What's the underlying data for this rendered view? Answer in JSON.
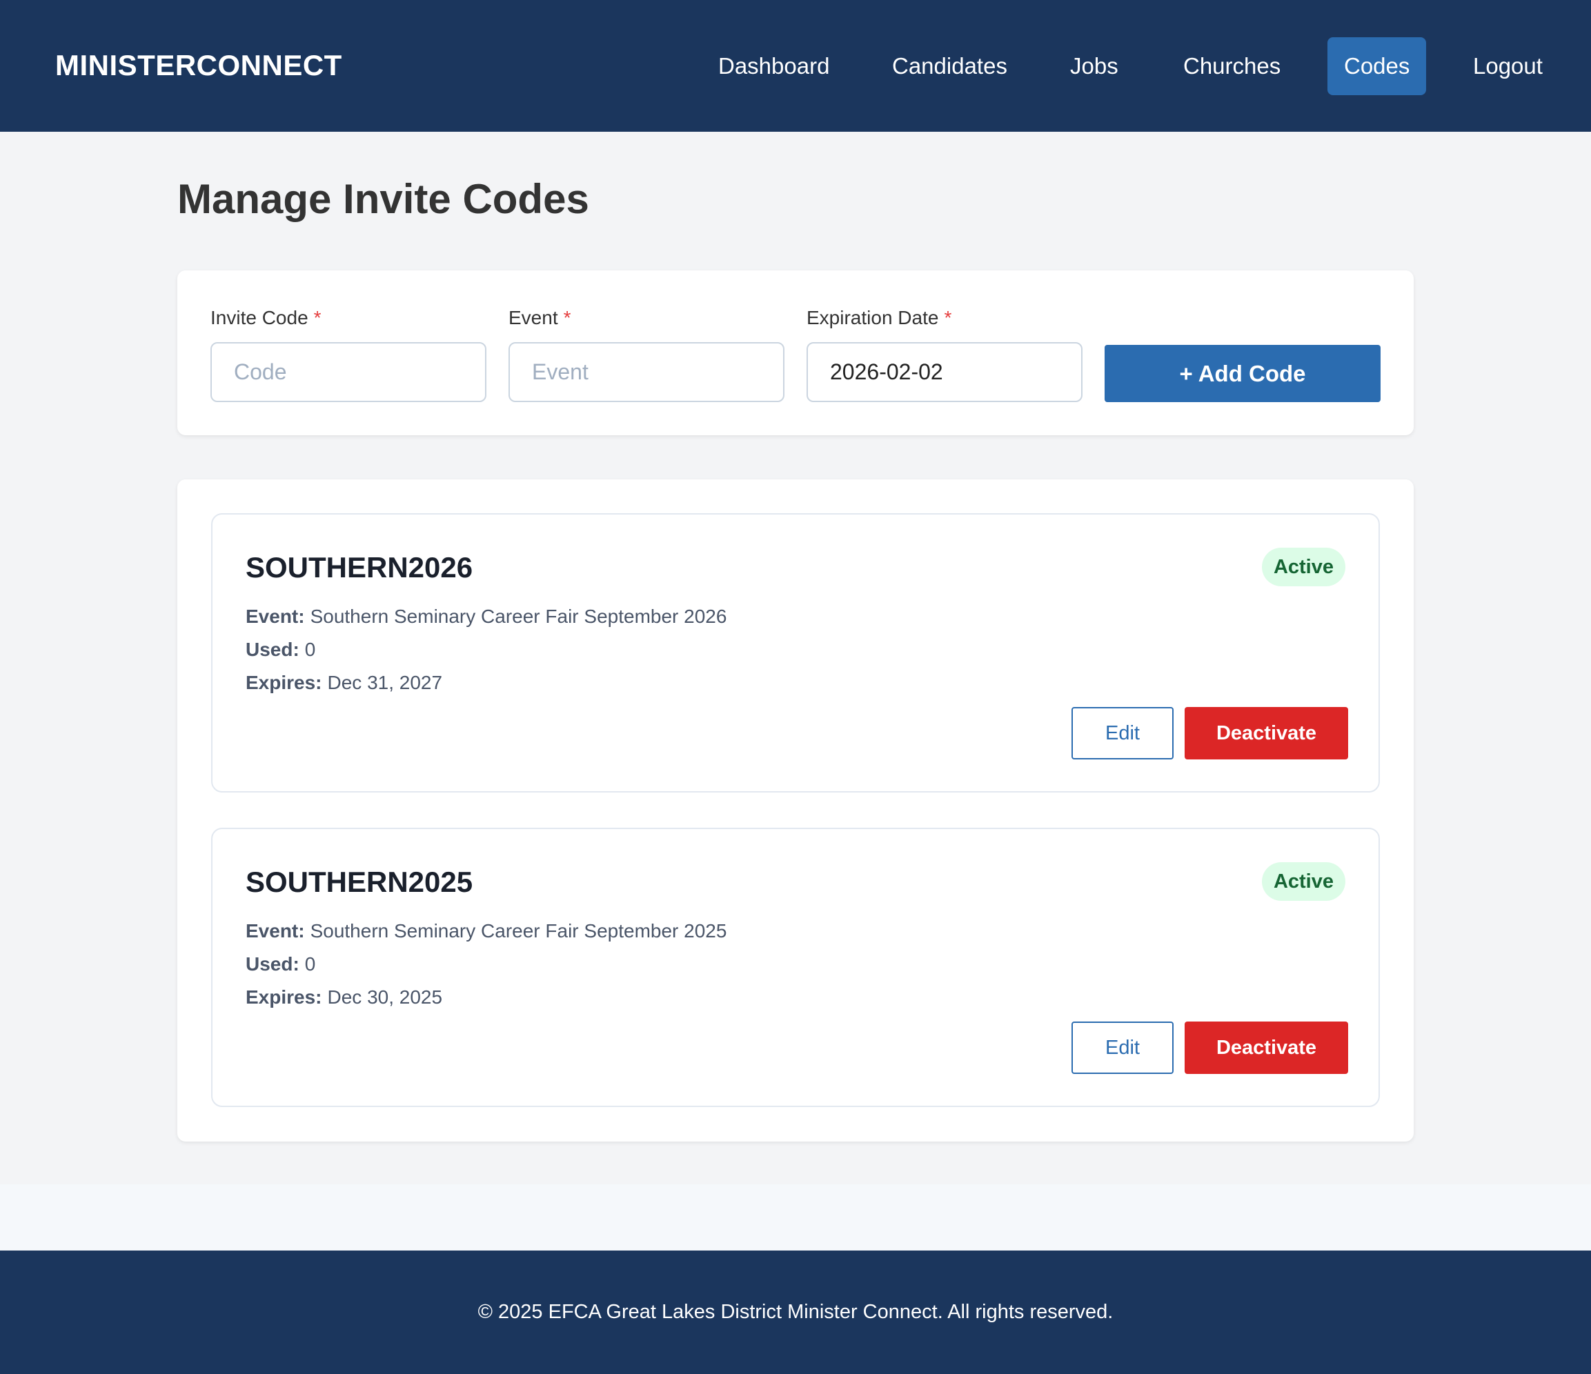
{
  "header": {
    "brand": "MINISTERCONNECT",
    "nav": {
      "dashboard": "Dashboard",
      "candidates": "Candidates",
      "jobs": "Jobs",
      "churches": "Churches",
      "codes": "Codes",
      "logout": "Logout"
    },
    "active_nav": "Codes"
  },
  "page": {
    "title": "Manage Invite Codes"
  },
  "form": {
    "invite_code": {
      "label": "Invite Code",
      "required_mark": "*",
      "placeholder": "Code",
      "value": ""
    },
    "event": {
      "label": "Event",
      "required_mark": "*",
      "placeholder": "Event",
      "value": ""
    },
    "expiration_date": {
      "label": "Expiration Date",
      "required_mark": "*",
      "value": "2026-02-02"
    },
    "add_button": "+ Add Code"
  },
  "codes": [
    {
      "code": "SOUTHERN2026",
      "status": "Active",
      "event_label": "Event:",
      "event": "Southern Seminary Career Fair September 2026",
      "used_label": "Used:",
      "used": "0",
      "expires_label": "Expires:",
      "expires": "Dec 31, 2027",
      "edit_label": "Edit",
      "deactivate_label": "Deactivate"
    },
    {
      "code": "SOUTHERN2025",
      "status": "Active",
      "event_label": "Event:",
      "event": "Southern Seminary Career Fair September 2025",
      "used_label": "Used:",
      "used": "0",
      "expires_label": "Expires:",
      "expires": "Dec 30, 2025",
      "edit_label": "Edit",
      "deactivate_label": "Deactivate"
    }
  ],
  "footer": {
    "text": "© 2025 EFCA Great Lakes District Minister Connect. All rights reserved."
  },
  "colors": {
    "header_bg": "#1b365d",
    "primary": "#2b6cb0",
    "danger": "#dc2626",
    "active_badge_bg": "#dcfce7",
    "active_badge_text": "#166534",
    "page_bg": "#f3f4f6"
  }
}
